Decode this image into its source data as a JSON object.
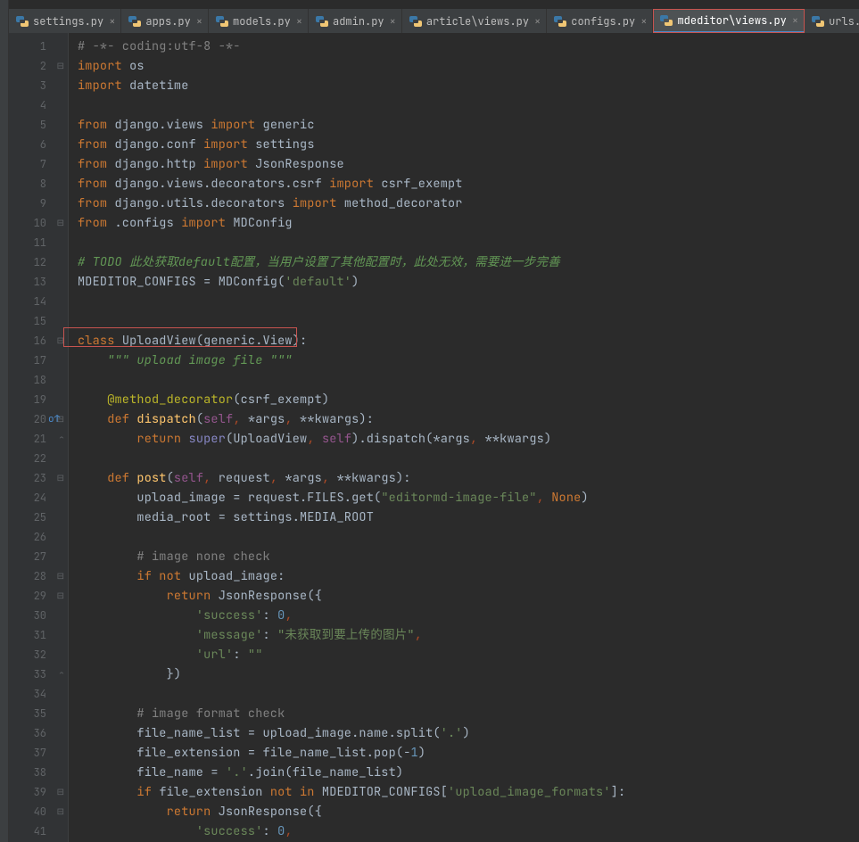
{
  "tabs": [
    {
      "label": "settings.py",
      "active": false
    },
    {
      "label": "apps.py",
      "active": false
    },
    {
      "label": "models.py",
      "active": false
    },
    {
      "label": "admin.py",
      "active": false
    },
    {
      "label": "article\\views.py",
      "active": false
    },
    {
      "label": "configs.py",
      "active": false
    },
    {
      "label": "mdeditor\\views.py",
      "active": true,
      "highlighted": true
    },
    {
      "label": "urls.py",
      "active": false
    }
  ],
  "code": {
    "lines": [
      {
        "n": 1,
        "tokens": [
          {
            "t": "# -*- coding:utf-8 -*-",
            "c": "comment"
          }
        ]
      },
      {
        "n": 2,
        "fold": "-",
        "tokens": [
          {
            "t": "import ",
            "c": "kw"
          },
          {
            "t": "os",
            "c": "op"
          }
        ]
      },
      {
        "n": 3,
        "tokens": [
          {
            "t": "import ",
            "c": "kw"
          },
          {
            "t": "datetime",
            "c": "op"
          }
        ]
      },
      {
        "n": 4,
        "tokens": []
      },
      {
        "n": 5,
        "tokens": [
          {
            "t": "from ",
            "c": "kw"
          },
          {
            "t": "django.views ",
            "c": "op"
          },
          {
            "t": "import ",
            "c": "kw"
          },
          {
            "t": "generic",
            "c": "op"
          }
        ]
      },
      {
        "n": 6,
        "tokens": [
          {
            "t": "from ",
            "c": "kw"
          },
          {
            "t": "django.conf ",
            "c": "op"
          },
          {
            "t": "import ",
            "c": "kw"
          },
          {
            "t": "settings",
            "c": "op"
          }
        ]
      },
      {
        "n": 7,
        "tokens": [
          {
            "t": "from ",
            "c": "kw"
          },
          {
            "t": "django.http ",
            "c": "op"
          },
          {
            "t": "import ",
            "c": "kw"
          },
          {
            "t": "JsonResponse",
            "c": "op"
          }
        ]
      },
      {
        "n": 8,
        "tokens": [
          {
            "t": "from ",
            "c": "kw"
          },
          {
            "t": "django.views.decorators.csrf ",
            "c": "op"
          },
          {
            "t": "import ",
            "c": "kw"
          },
          {
            "t": "csrf_exempt",
            "c": "op"
          }
        ]
      },
      {
        "n": 9,
        "tokens": [
          {
            "t": "from ",
            "c": "kw"
          },
          {
            "t": "django.utils.decorators ",
            "c": "op"
          },
          {
            "t": "import ",
            "c": "kw"
          },
          {
            "t": "method_decorator",
            "c": "op"
          }
        ]
      },
      {
        "n": 10,
        "fold": "-",
        "tokens": [
          {
            "t": "from ",
            "c": "kw"
          },
          {
            "t": ".configs ",
            "c": "op"
          },
          {
            "t": "import ",
            "c": "kw"
          },
          {
            "t": "MDConfig",
            "c": "op"
          }
        ]
      },
      {
        "n": 11,
        "tokens": []
      },
      {
        "n": 12,
        "tokens": [
          {
            "t": "# TODO 此处获取default配置，当用户设置了其他配置时，此处无效，需要进一步完善",
            "c": "comment-it"
          }
        ]
      },
      {
        "n": 13,
        "tokens": [
          {
            "t": "MDEDITOR_CONFIGS = MDConfig(",
            "c": "op"
          },
          {
            "t": "'default'",
            "c": "str"
          },
          {
            "t": ")",
            "c": "op"
          }
        ]
      },
      {
        "n": 14,
        "tokens": []
      },
      {
        "n": 15,
        "tokens": []
      },
      {
        "n": 16,
        "fold": "-",
        "boxed": true,
        "tokens": [
          {
            "t": "class ",
            "c": "kw"
          },
          {
            "t": "UploadView",
            "c": "cls"
          },
          {
            "t": "(generic.View):",
            "c": "op"
          }
        ]
      },
      {
        "n": 17,
        "tokens": [
          {
            "t": "    ",
            "c": "op"
          },
          {
            "t": "\"\"\" upload image file \"\"\"",
            "c": "docstr"
          }
        ]
      },
      {
        "n": 18,
        "tokens": []
      },
      {
        "n": 19,
        "tokens": [
          {
            "t": "    ",
            "c": "op"
          },
          {
            "t": "@method_decorator",
            "c": "dec"
          },
          {
            "t": "(csrf_exempt)",
            "c": "op"
          }
        ]
      },
      {
        "n": 20,
        "fold": "-",
        "override": true,
        "tokens": [
          {
            "t": "    ",
            "c": "op"
          },
          {
            "t": "def ",
            "c": "kw"
          },
          {
            "t": "dispatch",
            "c": "fn"
          },
          {
            "t": "(",
            "c": "op"
          },
          {
            "t": "self",
            "c": "self"
          },
          {
            "t": ", ",
            "c": "param"
          },
          {
            "t": "*args",
            "c": "op"
          },
          {
            "t": ", ",
            "c": "param"
          },
          {
            "t": "**kwargs):",
            "c": "op"
          }
        ]
      },
      {
        "n": 21,
        "fold": "^",
        "tokens": [
          {
            "t": "        ",
            "c": "op"
          },
          {
            "t": "return ",
            "c": "kw"
          },
          {
            "t": "super",
            "c": "builtin"
          },
          {
            "t": "(UploadView",
            "c": "op"
          },
          {
            "t": ", ",
            "c": "param"
          },
          {
            "t": "self",
            "c": "self"
          },
          {
            "t": ").dispatch(*args",
            "c": "op"
          },
          {
            "t": ", ",
            "c": "param"
          },
          {
            "t": "**kwargs)",
            "c": "op"
          }
        ]
      },
      {
        "n": 22,
        "tokens": []
      },
      {
        "n": 23,
        "fold": "-",
        "tokens": [
          {
            "t": "    ",
            "c": "op"
          },
          {
            "t": "def ",
            "c": "kw"
          },
          {
            "t": "post",
            "c": "fn"
          },
          {
            "t": "(",
            "c": "op"
          },
          {
            "t": "self",
            "c": "self"
          },
          {
            "t": ", ",
            "c": "param"
          },
          {
            "t": "request",
            "c": "op"
          },
          {
            "t": ", ",
            "c": "param"
          },
          {
            "t": "*args",
            "c": "op"
          },
          {
            "t": ", ",
            "c": "param"
          },
          {
            "t": "**kwargs):",
            "c": "op"
          }
        ]
      },
      {
        "n": 24,
        "tokens": [
          {
            "t": "        upload_image = request.FILES.get(",
            "c": "op"
          },
          {
            "t": "\"editormd-image-file\"",
            "c": "str"
          },
          {
            "t": ", ",
            "c": "param"
          },
          {
            "t": "None",
            "c": "kw"
          },
          {
            "t": ")",
            "c": "op"
          }
        ]
      },
      {
        "n": 25,
        "tokens": [
          {
            "t": "        media_root = settings.MEDIA_ROOT",
            "c": "op"
          }
        ]
      },
      {
        "n": 26,
        "tokens": []
      },
      {
        "n": 27,
        "tokens": [
          {
            "t": "        ",
            "c": "op"
          },
          {
            "t": "# image none check",
            "c": "comment"
          }
        ]
      },
      {
        "n": 28,
        "fold": "-",
        "tokens": [
          {
            "t": "        ",
            "c": "op"
          },
          {
            "t": "if not ",
            "c": "kw"
          },
          {
            "t": "upload_image:",
            "c": "op"
          }
        ]
      },
      {
        "n": 29,
        "fold": "-",
        "tokens": [
          {
            "t": "            ",
            "c": "op"
          },
          {
            "t": "return ",
            "c": "kw"
          },
          {
            "t": "JsonResponse({",
            "c": "op"
          }
        ]
      },
      {
        "n": 30,
        "tokens": [
          {
            "t": "                ",
            "c": "op"
          },
          {
            "t": "'success'",
            "c": "str"
          },
          {
            "t": ": ",
            "c": "op"
          },
          {
            "t": "0",
            "c": "num"
          },
          {
            "t": ",",
            "c": "param"
          }
        ]
      },
      {
        "n": 31,
        "tokens": [
          {
            "t": "                ",
            "c": "op"
          },
          {
            "t": "'message'",
            "c": "str"
          },
          {
            "t": ": ",
            "c": "op"
          },
          {
            "t": "\"未获取到要上传的图片\"",
            "c": "str"
          },
          {
            "t": ",",
            "c": "param"
          }
        ]
      },
      {
        "n": 32,
        "tokens": [
          {
            "t": "                ",
            "c": "op"
          },
          {
            "t": "'url'",
            "c": "str"
          },
          {
            "t": ": ",
            "c": "op"
          },
          {
            "t": "\"\"",
            "c": "str"
          }
        ]
      },
      {
        "n": 33,
        "fold": "^",
        "tokens": [
          {
            "t": "            })",
            "c": "op"
          }
        ]
      },
      {
        "n": 34,
        "tokens": []
      },
      {
        "n": 35,
        "tokens": [
          {
            "t": "        ",
            "c": "op"
          },
          {
            "t": "# image format check",
            "c": "comment"
          }
        ]
      },
      {
        "n": 36,
        "tokens": [
          {
            "t": "        file_name_list = upload_image.name.split(",
            "c": "op"
          },
          {
            "t": "'.'",
            "c": "str"
          },
          {
            "t": ")",
            "c": "op"
          }
        ]
      },
      {
        "n": 37,
        "tokens": [
          {
            "t": "        file_extension = file_name_list.pop(-",
            "c": "op"
          },
          {
            "t": "1",
            "c": "num"
          },
          {
            "t": ")",
            "c": "op"
          }
        ]
      },
      {
        "n": 38,
        "tokens": [
          {
            "t": "        file_name = ",
            "c": "op"
          },
          {
            "t": "'.'",
            "c": "str"
          },
          {
            "t": ".join(file_name_list)",
            "c": "op"
          }
        ]
      },
      {
        "n": 39,
        "fold": "-",
        "tokens": [
          {
            "t": "        ",
            "c": "op"
          },
          {
            "t": "if ",
            "c": "kw"
          },
          {
            "t": "file_extension ",
            "c": "op"
          },
          {
            "t": "not in ",
            "c": "kw"
          },
          {
            "t": "MDEDITOR_CONFIGS[",
            "c": "op"
          },
          {
            "t": "'upload_image_formats'",
            "c": "str"
          },
          {
            "t": "]:",
            "c": "op"
          }
        ]
      },
      {
        "n": 40,
        "fold": "-",
        "tokens": [
          {
            "t": "            ",
            "c": "op"
          },
          {
            "t": "return ",
            "c": "kw"
          },
          {
            "t": "JsonResponse({",
            "c": "op"
          }
        ]
      },
      {
        "n": 41,
        "tokens": [
          {
            "t": "                ",
            "c": "op"
          },
          {
            "t": "'success'",
            "c": "str"
          },
          {
            "t": ": ",
            "c": "op"
          },
          {
            "t": "0",
            "c": "num"
          },
          {
            "t": ",",
            "c": "param"
          }
        ]
      }
    ]
  }
}
